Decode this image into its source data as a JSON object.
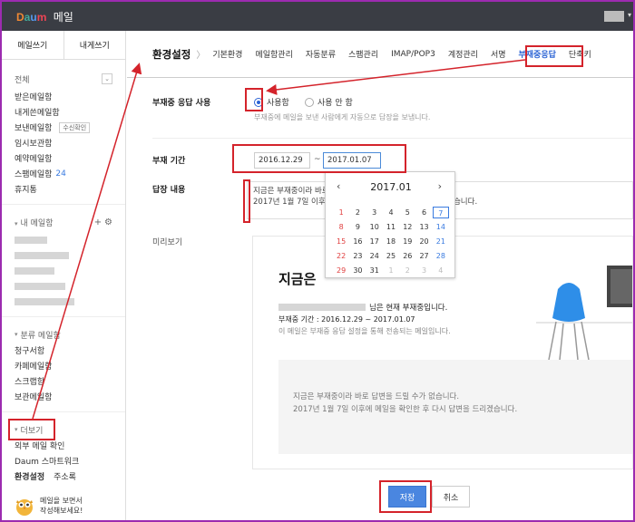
{
  "app": {
    "logo": "Daum",
    "name": "메일"
  },
  "sidebar": {
    "compose_label": "메일쓰기",
    "self_compose_label": "내게쓰기",
    "all_label": "전체",
    "mailboxes": [
      {
        "label": "받은메일함"
      },
      {
        "label": "내게쓴메일함"
      },
      {
        "label": "보낸메일함",
        "tag": "수신확인"
      },
      {
        "label": "임시보관함"
      },
      {
        "label": "예약메일함"
      },
      {
        "label": "스팸메일함",
        "count": "24"
      },
      {
        "label": "휴지통"
      }
    ],
    "my_mailbox_label": "내 메일함",
    "category_label": "분류 메일함",
    "category_items": [
      "청구서함",
      "카페메일함",
      "스크랩함",
      "보관메일함"
    ],
    "more_label": "더보기",
    "more_items": [
      "외부 메일 확인",
      "Daum 스마트워크"
    ],
    "settings_label": "환경설정",
    "address_book_label": "주소록",
    "promo_text_1": "메일을 보면서",
    "promo_text_2": "작성해보세요!"
  },
  "tabs": {
    "title": "환경설정",
    "items": [
      "기본환경",
      "메일함관리",
      "자동분류",
      "스팸관리",
      "IMAP/POP3",
      "계정관리",
      "서명",
      "부재중응답",
      "단축키"
    ],
    "active": "부재중응답"
  },
  "form": {
    "use_label": "부재중 응답 사용",
    "opt_on": "사용함",
    "opt_off": "사용 안 함",
    "use_desc": "부재중에 메일을 보낸 사람에게 자동으로 답장을 보냅니다.",
    "period_label": "부재 기간",
    "start_date": "2016.12.29",
    "tilde": "~",
    "end_date": "2017.01.07",
    "reply_label": "답장 내용",
    "reply_line1": "지금은 부재중이라 바로 답변을 드릴 수가 없습니다.",
    "reply_line2": "2017년 1월 7일 이후에 메일을 확인한 후 다시 답변을 드리겠습니다.",
    "preview_label": "미리보기"
  },
  "calendar": {
    "month_label": "2017.01",
    "prev": "‹",
    "next": "›",
    "weeks": [
      [
        "1",
        "2",
        "3",
        "4",
        "5",
        "6",
        "7"
      ],
      [
        "8",
        "9",
        "10",
        "11",
        "12",
        "13",
        "14"
      ],
      [
        "15",
        "16",
        "17",
        "18",
        "19",
        "20",
        "21"
      ],
      [
        "22",
        "23",
        "24",
        "25",
        "26",
        "27",
        "28"
      ],
      [
        "29",
        "30",
        "31",
        "1",
        "2",
        "3",
        "4"
      ]
    ],
    "selected": "7"
  },
  "preview": {
    "title": "지금은",
    "line1_suffix": "님은 현재 부재중입니다.",
    "line2": "부재중 기간 : 2016.12.29 ~ 2017.01.07",
    "line3": "이 메일은 부재중 응답 설정을 통해 전송되는 메일입니다.",
    "body1": "지금은 부재중이라 바로 답변을 드릴 수가 없습니다.",
    "body2": "2017년 1월 7일 이후에 메일을 확인한 후 다시 답변을 드리겠습니다."
  },
  "buttons": {
    "save": "저장",
    "cancel": "취소"
  },
  "colors": {
    "accent": "#2a62d4",
    "highlight": "#d4232b",
    "frame": "#9c2bb0",
    "topbar": "#3a3d44",
    "chair": "#2e8ee8"
  }
}
